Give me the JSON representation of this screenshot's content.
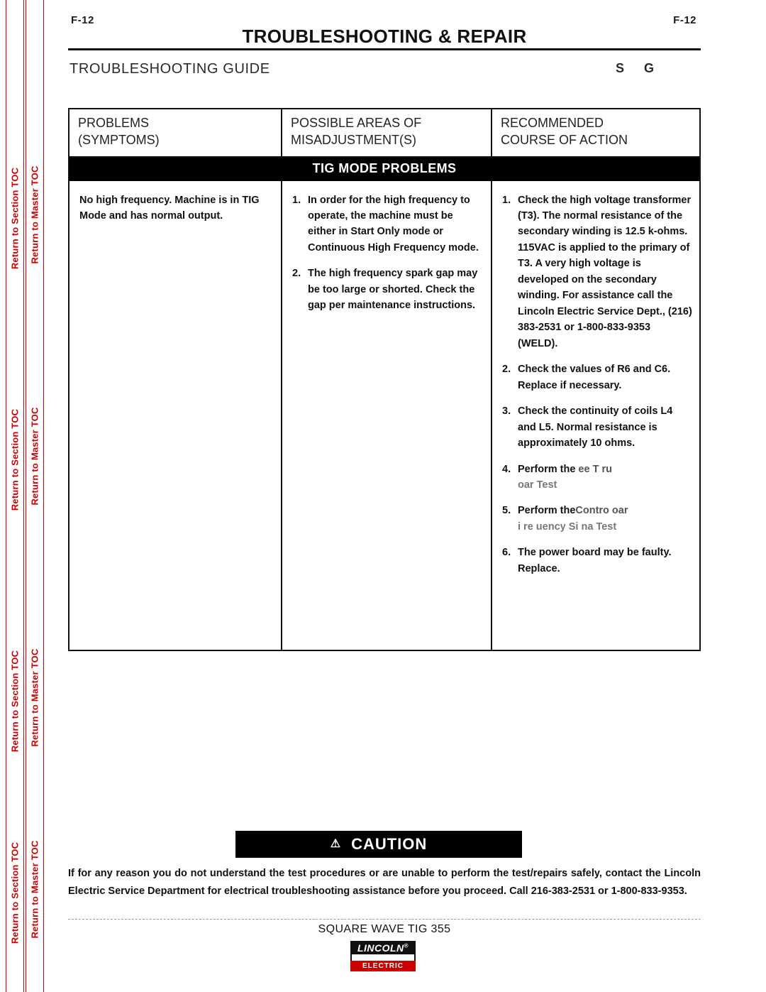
{
  "rails": {
    "section_toc_label": "Return to Section TOC",
    "master_toc_label": "Return to Master TOC"
  },
  "header": {
    "page_number_left": "F-12",
    "page_number_right": "F-12",
    "title": "TROUBLESHOOTING & REPAIR",
    "guide_title": "TROUBLESHOOTING GUIDE",
    "guide_right_mark": "SG"
  },
  "table": {
    "headers": [
      "PROBLEMS\n(SYMPTOMS)",
      "POSSIBLE AREAS OF\nMISADJUSTMENT(S)",
      "RECOMMENDED\nCOURSE OF ACTION"
    ],
    "header_line1": [
      "PROBLEMS",
      "POSSIBLE AREAS OF",
      "RECOMMENDED"
    ],
    "header_line2": [
      "(SYMPTOMS)",
      "MISADJUSTMENT(S)",
      "COURSE OF ACTION"
    ],
    "band_label": "TIG MODE PROBLEMS",
    "problem": "No high frequency.  Machine is in TIG Mode and has normal output.",
    "misadjustments": [
      {
        "num": "1.",
        "text": "In order for the high frequency to operate, the machine must be either in Start Only mode or Continuous High Frequency mode."
      },
      {
        "num": "2.",
        "text": "The high frequency spark gap may be too large or shorted.  Check the gap per maintenance instructions."
      }
    ],
    "actions": [
      {
        "num": "1.",
        "text": "Check the high voltage transformer (T3).  The normal resistance of the secondary winding is 12.5 k-ohms.  115VAC is applied to the primary of T3.  A very high voltage is developed on the secondary winding.  For assistance call the Lincoln Electric Service Dept., (216) 383-2531 or 1-800-833-9353 (WELD)."
      },
      {
        "num": "2.",
        "text": "Check the values of R6 and C6.  Replace if necessary."
      },
      {
        "num": "3.",
        "text": "Check the continuity of coils L4 and L5.  Normal resistance is approximately 10 ohms."
      },
      {
        "num": "4.",
        "text_parts": [
          {
            "t": "Perform the ",
            "style": "normal"
          },
          {
            "t": "ee     T ru",
            "style": "faded"
          },
          {
            "t": " oar    Test",
            "style": "faded"
          }
        ]
      },
      {
        "num": "5.",
        "text_parts": [
          {
            "t": "Perform the",
            "style": "normal"
          },
          {
            "t": "Contro    oar",
            "style": "faded"
          },
          {
            "t": "i     re uency Si na  Test",
            "style": "faded"
          }
        ]
      },
      {
        "num": "6.",
        "text": "The power board may be faulty.  Replace."
      }
    ]
  },
  "caution": {
    "label": "CAUTION",
    "symbol": "⚠",
    "body": "If for any reason you do not understand the test procedures or are unable to perform the test/repairs safely, contact the Lincoln Electric Service Department for electrical troubleshooting assistance before you proceed.  Call 216-383-2531 or 1-800-833-9353."
  },
  "footer": {
    "model": "SQUARE WAVE TIG 355",
    "logo_top": "LINCOLN",
    "logo_reg": "®",
    "logo_bottom": "ELECTRIC"
  }
}
